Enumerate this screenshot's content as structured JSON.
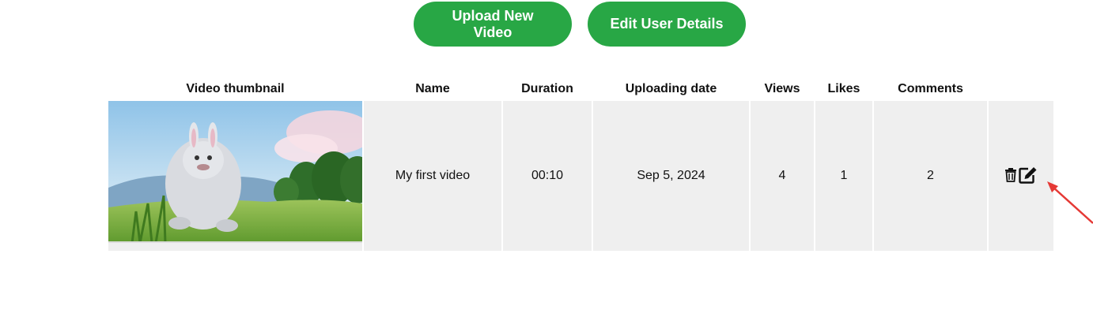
{
  "toolbar": {
    "upload_label": "Upload New Video",
    "edit_user_label": "Edit User Details"
  },
  "table": {
    "headers": {
      "thumbnail": "Video thumbnail",
      "name": "Name",
      "duration": "Duration",
      "upload_date": "Uploading date",
      "views": "Views",
      "likes": "Likes",
      "comments": "Comments"
    },
    "rows": [
      {
        "thumbnail_image": "video-thumbnail-image",
        "name": "My first video",
        "duration": "00:10",
        "upload_date": "Sep 5, 2024",
        "views": "4",
        "likes": "1",
        "comments": "2",
        "actions": [
          "trash-icon",
          "edit-icon"
        ]
      }
    ]
  },
  "colors": {
    "button_green": "#28a745",
    "cell_background": "#efefef",
    "annotation_arrow": "#e53935"
  }
}
